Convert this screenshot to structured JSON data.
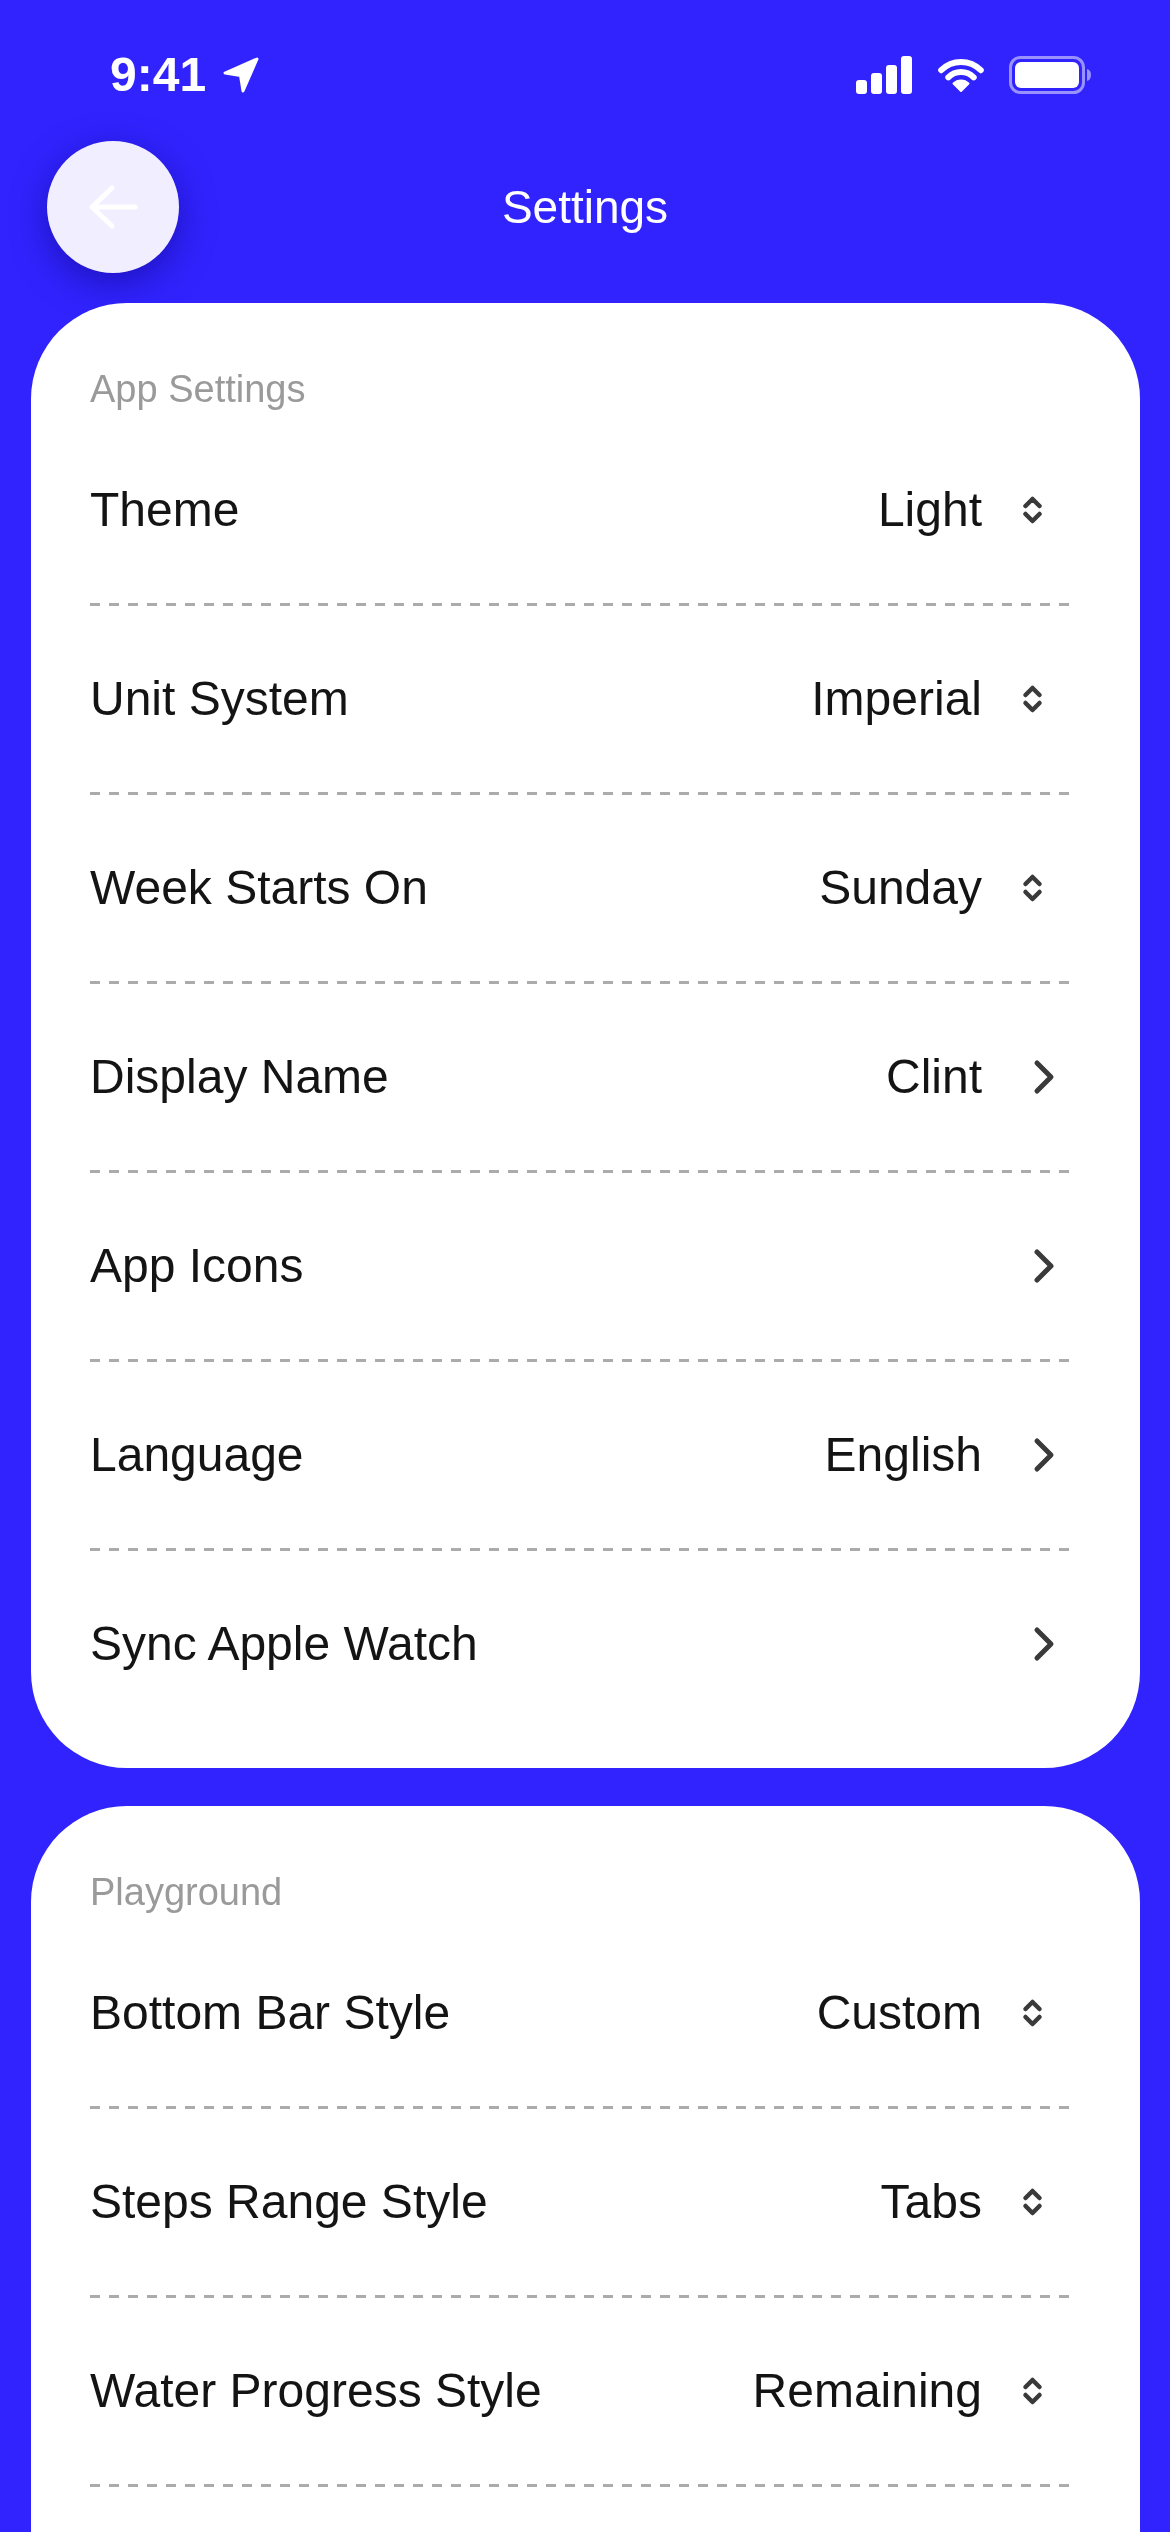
{
  "status_bar": {
    "time": "9:41"
  },
  "header": {
    "title": "Settings"
  },
  "sections": [
    {
      "title": "App Settings",
      "rows": [
        {
          "label": "Theme",
          "value": "Light",
          "kind": "picker"
        },
        {
          "label": "Unit System",
          "value": "Imperial",
          "kind": "picker"
        },
        {
          "label": "Week Starts On",
          "value": "Sunday",
          "kind": "picker"
        },
        {
          "label": "Display Name",
          "value": "Clint",
          "kind": "link"
        },
        {
          "label": "App Icons",
          "kind": "link"
        },
        {
          "label": "Language",
          "value": "English",
          "kind": "link"
        },
        {
          "label": "Sync Apple Watch",
          "kind": "link"
        }
      ]
    },
    {
      "title": "Playground",
      "clipped": true,
      "rows": [
        {
          "label": "Bottom Bar Style",
          "value": "Custom",
          "kind": "picker"
        },
        {
          "label": "Steps Range Style",
          "value": "Tabs",
          "kind": "picker"
        },
        {
          "label": "Water Progress Style",
          "value": "Remaining",
          "kind": "picker"
        }
      ]
    }
  ]
}
